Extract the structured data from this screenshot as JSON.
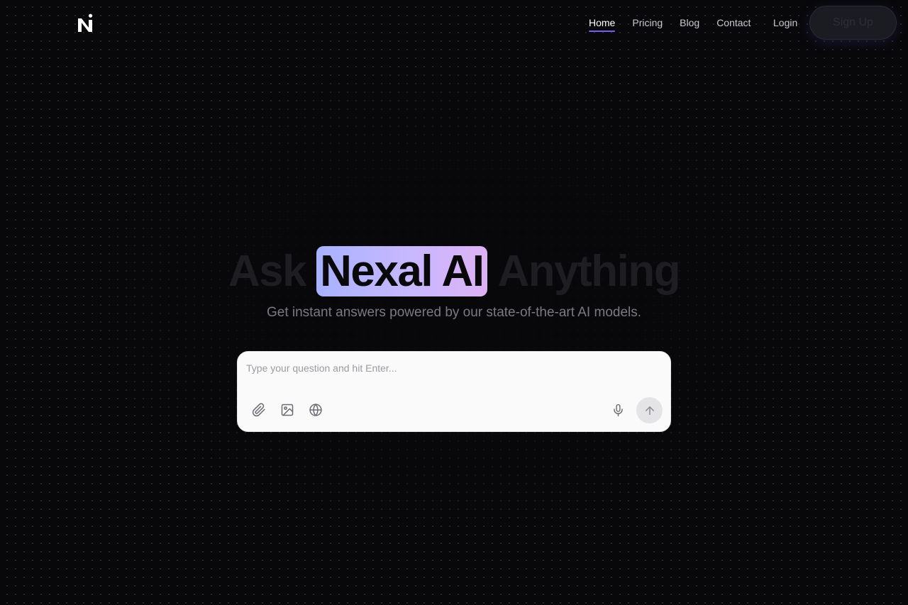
{
  "brand": {
    "logo_icon": "nexal-n-logo-icon"
  },
  "nav": {
    "items": [
      {
        "label": "Home",
        "active": true
      },
      {
        "label": "Pricing",
        "active": false
      },
      {
        "label": "Blog",
        "active": false
      },
      {
        "label": "Contact",
        "active": false
      }
    ],
    "login_label": "Login",
    "signup_label": "Sign Up"
  },
  "hero": {
    "title_before": "Ask",
    "title_highlight": "Nexal AI",
    "title_after": "Anything",
    "subtitle": "Get instant answers powered by our state-of-the-art AI models."
  },
  "prompt": {
    "placeholder": "Type your question and hit Enter...",
    "value": "",
    "tools": [
      "paperclip-icon",
      "image-icon",
      "globe-icon"
    ],
    "mic_icon": "microphone-icon",
    "send_icon": "arrow-up-icon"
  },
  "colors": {
    "background": "#08080a",
    "accent": "#7c5cf5",
    "highlight_start": "#a8b2ff",
    "highlight_end": "#ddb2f4",
    "card": "#fafafa"
  }
}
